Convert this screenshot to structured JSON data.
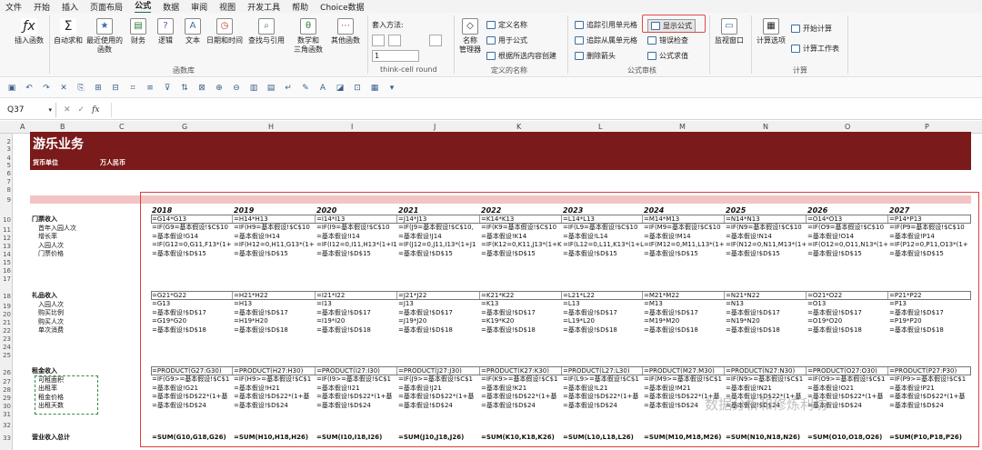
{
  "menu": [
    "文件",
    "开始",
    "插入",
    "页面布局",
    "公式",
    "数据",
    "审阅",
    "视图",
    "开发工具",
    "帮助",
    "Choice数据"
  ],
  "ribbon": {
    "insert_fn": "插入函数",
    "autosum": "自动求和",
    "recent": "最近使用的\n函数",
    "finance": "财务",
    "logic": "逻辑",
    "text": "文本",
    "datetime": "日期和时间",
    "lookup": "查找与引用",
    "math": "数学和\n三角函数",
    "other": "其他函数",
    "group_lib": "函数库",
    "insert_method": "套入方法:",
    "spin_value": "1",
    "thinkcell": "think-cell round",
    "name_mgr": "名称\n管理器",
    "define_name": "定义名称",
    "use_in_formula": "用于公式",
    "create_from_sel": "根据所选内容创建",
    "group_names": "定义的名称",
    "trace_prec": "追踪引用单元格",
    "trace_dep": "追踪从属单元格",
    "remove_arrows": "删除箭头",
    "show_formulas": "显示公式",
    "error_check": "错误检查",
    "evaluate": "公式求值",
    "group_audit": "公式审核",
    "watch": "监视窗口",
    "calc_opts": "计算选项",
    "calc_now": "开始计算",
    "calc_sheet": "计算工作表",
    "group_calc": "计算"
  },
  "namebox": "Q37",
  "fx": "fx",
  "columns": [
    "A",
    "B",
    "C",
    "G",
    "H",
    "I",
    "J",
    "K",
    "L",
    "M",
    "N",
    "O",
    "P"
  ],
  "rows": [
    "2",
    "3",
    "4",
    "5",
    "6",
    "7",
    "8",
    "9",
    "10",
    "11",
    "12",
    "13",
    "14",
    "15",
    "16",
    "17",
    "18",
    "19",
    "20",
    "21",
    "22",
    "23",
    "24",
    "25",
    "26",
    "27",
    "28",
    "29",
    "30",
    "31",
    "32",
    "33"
  ],
  "sheet": {
    "title": "游乐业务",
    "currency_label": "货币单位",
    "currency_value": "万人民币",
    "years": [
      "2018",
      "2019",
      "2020",
      "2021",
      "2022",
      "2023",
      "2024",
      "2025",
      "2026",
      "2027"
    ],
    "sec1_title": "门票收入",
    "sec1_items": [
      "首年入园人次",
      "增长率",
      "入园人次",
      "门票价格"
    ],
    "sec1_rows": [
      [
        "=G14*G13",
        "=H14*H13",
        "=I14*I13",
        "=J14*J13",
        "=K14*K13",
        "=L14*L13",
        "=M14*M13",
        "=N14*N13",
        "=O14*O13",
        "=P14*P13"
      ],
      [
        "=IF(G9=基本假设!$C$10",
        "=IF(H9=基本假设!$C$10",
        "=IF(I9=基本假设!$C$10",
        "=IF(J9=基本假设!$C$10,",
        "=IF(K9=基本假设!$C$10",
        "=IF(L9=基本假设!$C$10",
        "=IF(M9=基本假设!$C$10",
        "=IF(N9=基本假设!$C$10",
        "=IF(O9=基本假设!$C$10",
        "=IF(P9=基本假设!$C$10"
      ],
      [
        "=基本假设!G14",
        "=基本假设!H14",
        "=基本假设!I14",
        "=基本假设!J14",
        "=基本假设!K14",
        "=基本假设!L14",
        "=基本假设!M14",
        "=基本假设!N14",
        "=基本假设!O14",
        "=基本假设!P14"
      ],
      [
        "=IF(G12=0,G11,F13*(1+",
        "=IF(H12=0,H11,G13*(1+",
        "=IF(I12=0,I11,H13*(1+I1",
        "=IF(J12=0,J11,I13*(1+J1",
        "=IF(K12=0,K11,J13*(1+K1",
        "=IF(L12=0,L11,K13*(1+L",
        "=IF(M12=0,M11,L13*(1+",
        "=IF(N12=0,N11,M13*(1+",
        "=IF(O12=0,O11,N13*(1+",
        "=IF(P12=0,P11,O13*(1+"
      ],
      [
        "=基本假设!$D$15",
        "=基本假设!$D$15",
        "=基本假设!$D$15",
        "=基本假设!$D$15",
        "=基本假设!$D$15",
        "=基本假设!$D$15",
        "=基本假设!$D$15",
        "=基本假设!$D$15",
        "=基本假设!$D$15",
        "=基本假设!$D$15"
      ]
    ],
    "sec2_title": "礼品收入",
    "sec2_items": [
      "入园人次",
      "购买比例",
      "购买人次",
      "单次消费"
    ],
    "sec2_rows": [
      [
        "=G21*G22",
        "=H21*H22",
        "=I21*I22",
        "=J21*J22",
        "=K21*K22",
        "=L21*L22",
        "=M21*M22",
        "=N21*N22",
        "=O21*O22",
        "=P21*P22"
      ],
      [
        "=G13",
        "=H13",
        "=I13",
        "=J13",
        "=K13",
        "=L13",
        "=M13",
        "=N13",
        "=O13",
        "=P13"
      ],
      [
        "=基本假设!$D$17",
        "=基本假设!$D$17",
        "=基本假设!$D$17",
        "=基本假设!$D$17",
        "=基本假设!$D$17",
        "=基本假设!$D$17",
        "=基本假设!$D$17",
        "=基本假设!$D$17",
        "=基本假设!$D$17",
        "=基本假设!$D$17"
      ],
      [
        "=G19*G20",
        "=H19*H20",
        "=I19*I20",
        "=J19*J20",
        "=K19*K20",
        "=L19*L20",
        "=M19*M20",
        "=N19*N20",
        "=O19*O20",
        "=P19*P20"
      ],
      [
        "=基本假设!$D$18",
        "=基本假设!$D$18",
        "=基本假设!$D$18",
        "=基本假设!$D$18",
        "=基本假设!$D$18",
        "=基本假设!$D$18",
        "=基本假设!$D$18",
        "=基本假设!$D$18",
        "=基本假设!$D$18",
        "=基本假设!$D$18"
      ]
    ],
    "sec3_title": "租金收入",
    "sec3_items": [
      "可租面积",
      "出租率",
      "租金价格",
      "出租天数"
    ],
    "sec3_rows": [
      [
        "=PRODUCT(G27:G30)",
        "=PRODUCT(H27:H30)",
        "=PRODUCT(I27:I30)",
        "=PRODUCT(J27:J30)",
        "=PRODUCT(K27:K30)",
        "=PRODUCT(L27:L30)",
        "=PRODUCT(M27:M30)",
        "=PRODUCT(N27:N30)",
        "=PRODUCT(O27:O30)",
        "=PRODUCT(P27:P30)"
      ],
      [
        "=IF(G9>=基本假设!$C$1",
        "=IF(H9>=基本假设!$C$1",
        "=IF(I9>=基本假设!$C$1",
        "=IF(J9>=基本假设!$C$1",
        "=IF(K9>=基本假设!$C$1",
        "=IF(L9>=基本假设!$C$1",
        "=IF(M9>=基本假设!$C$1",
        "=IF(N9>=基本假设!$C$1",
        "=IF(O9>=基本假设!$C$1",
        "=IF(P9>=基本假设!$C$1"
      ],
      [
        "=基本假设!G21",
        "=基本假设!H21",
        "=基本假设!I21",
        "=基本假设!J21",
        "=基本假设!K21",
        "=基本假设!L21",
        "=基本假设!M21",
        "=基本假设!N21",
        "=基本假设!O21",
        "=基本假设!P21"
      ],
      [
        "=基本假设!$D$22*(1+基",
        "=基本假设!$D$22*(1+基",
        "=基本假设!$D$22*(1+基",
        "=基本假设!$D$22*(1+基",
        "=基本假设!$D$22*(1+基",
        "=基本假设!$D$22*(1+基",
        "=基本假设!$D$22*(1+基",
        "=基本假设!$D$22*(1+基",
        "=基本假设!$D$22*(1+基",
        "=基本假设!$D$22*(1+基"
      ],
      [
        "=基本假设!$D$24",
        "=基本假设!$D$24",
        "=基本假设!$D$24",
        "=基本假设!$D$24",
        "=基本假设!$D$24",
        "=基本假设!$D$24",
        "=基本假设!$D$24",
        "=基本假设!$D$24",
        "=基本假设!$D$24",
        "=基本假设!$D$24"
      ]
    ],
    "total_title": "营业收入总计",
    "total_row": [
      "=SUM(G10,G18,G26)",
      "=SUM(H10,H18,H26)",
      "=SUM(I10,I18,I26)",
      "=SUM(J10,J18,J26)",
      "=SUM(K10,K18,K26)",
      "=SUM(L10,L18,L26)",
      "=SUM(M10,M18,M26)",
      "=SUM(N10,N18,N26)",
      "=SUM(O10,O18,O26)",
      "=SUM(P10,P18,P26)"
    ]
  },
  "watermark": "数据分析和修炼利坊"
}
